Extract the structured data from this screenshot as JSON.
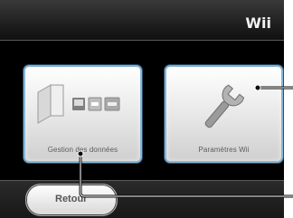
{
  "header": {
    "title": "Wii"
  },
  "tiles": [
    {
      "label": "Gestion des données",
      "icon": "console-data-icon"
    },
    {
      "label": "Paramètres Wii",
      "icon": "wrench-icon"
    }
  ],
  "footer": {
    "back_label": "Retour"
  },
  "colors": {
    "tile_border": "#86b6d7",
    "callout": "#0a0a0a"
  }
}
